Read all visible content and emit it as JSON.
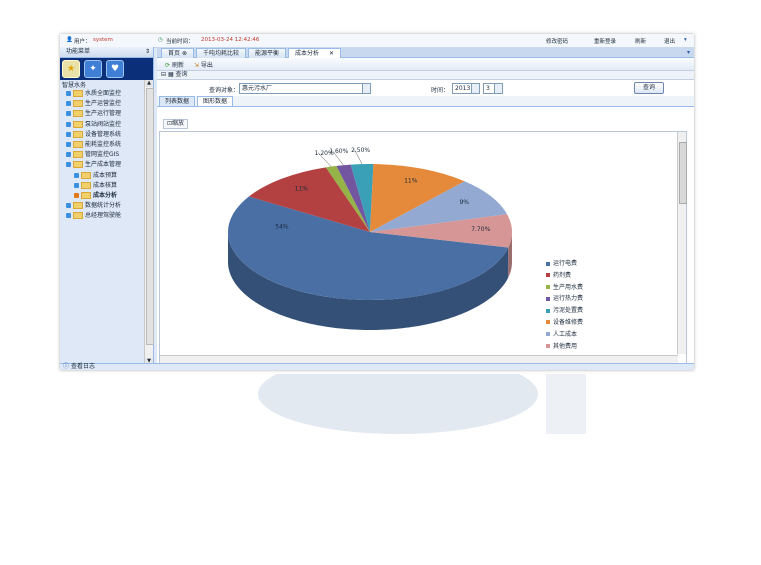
{
  "topbar": {
    "user_label": "用户：",
    "user_name": "system",
    "time_label": "当前时间：",
    "time_value": "2013-03-24 12:42:46",
    "actions": [
      "修改密码",
      "重新登录",
      "刷新",
      "退出"
    ]
  },
  "sidebar": {
    "header": "功能菜单",
    "tree_title": "智慧水务",
    "items": [
      {
        "label": "水质全面监控",
        "level": 0
      },
      {
        "label": "生产运营监控",
        "level": 0
      },
      {
        "label": "生产运行管理",
        "level": 0
      },
      {
        "label": "泵站阀站监控",
        "level": 0
      },
      {
        "label": "设备管理系统",
        "level": 0
      },
      {
        "label": "能耗监控系统",
        "level": 0
      },
      {
        "label": "管网监控GIS",
        "level": 0
      },
      {
        "label": "生产成本管理",
        "level": 0
      },
      {
        "label": "成本预算",
        "level": 1
      },
      {
        "label": "成本核算",
        "level": 1
      },
      {
        "label": "成本分析",
        "level": 1,
        "selected": true
      },
      {
        "label": "数据统计分析",
        "level": 0
      },
      {
        "label": "总经理驾驶舱",
        "level": 0
      }
    ]
  },
  "tabs": [
    {
      "label": "首页",
      "active": false
    },
    {
      "label": "千吨均耗比较",
      "active": false
    },
    {
      "label": "能源平衡",
      "active": false
    },
    {
      "label": "成本分析",
      "active": true
    }
  ],
  "toolbar": {
    "refresh": "刷新",
    "export": "导出"
  },
  "query": {
    "panel_title": "查询",
    "object_label": "查询对象：",
    "object_value": "惠元污水厂",
    "time_label": "时间：",
    "year": "2013",
    "month": "3",
    "button": "查询"
  },
  "subtabs": [
    {
      "label": "列表数据",
      "active": false
    },
    {
      "label": "图形数据",
      "active": true
    }
  ],
  "zoom_label": "缩放",
  "status_bar": "查看日志",
  "chart_data": {
    "type": "pie",
    "series": [
      {
        "name": "运行电费",
        "value": 54,
        "label": "54%",
        "color": "#4a6fa5"
      },
      {
        "name": "药剂费",
        "value": 11,
        "label": "11%",
        "color": "#b34141"
      },
      {
        "name": "生产用水费",
        "value": 1.2,
        "label": "1.20%",
        "color": "#96b347"
      },
      {
        "name": "运行热力费",
        "value": 1.6,
        "label": "1.60%",
        "color": "#7356a0"
      },
      {
        "name": "污泥处置费",
        "value": 2.5,
        "label": "2.50%",
        "color": "#3aa0b8"
      },
      {
        "name": "设备维修费",
        "value": 11,
        "label": "11%",
        "color": "#e48a3a"
      },
      {
        "name": "人工成本",
        "value": 9,
        "label": "9%",
        "color": "#93a9d2"
      },
      {
        "name": "其他费用",
        "value": 7.7,
        "label": "7.70%",
        "color": "#d69696"
      }
    ]
  }
}
